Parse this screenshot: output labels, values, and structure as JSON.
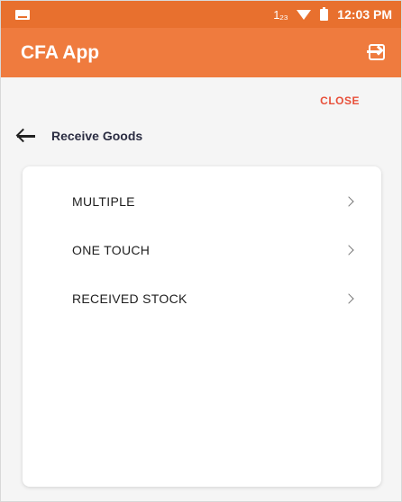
{
  "status_bar": {
    "indicator": "1₂₃",
    "time": "12:03 PM",
    "icons": [
      "notification-icon",
      "wifi-icon",
      "battery-icon"
    ]
  },
  "app_bar": {
    "title": "CFA App",
    "action_icon": "logout-icon"
  },
  "close_label": "CLOSE",
  "header": {
    "back_icon": "arrow-left-icon",
    "title": "Receive Goods"
  },
  "menu": {
    "items": [
      {
        "label": "MULTIPLE"
      },
      {
        "label": "ONE TOUCH"
      },
      {
        "label": "RECEIVED STOCK"
      }
    ],
    "chevron_icon": "chevron-right-icon"
  },
  "colors": {
    "status_bar": "#e8702e",
    "app_bar": "#ef7b3e",
    "close": "#e8503a",
    "title_text": "#2b2d42"
  }
}
